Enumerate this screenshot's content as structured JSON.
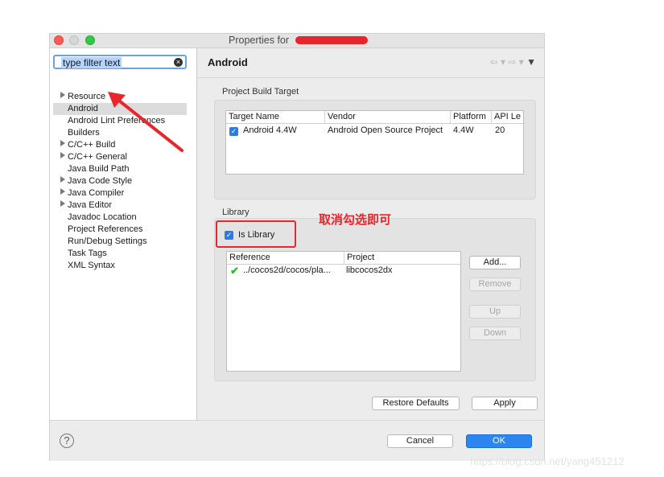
{
  "window": {
    "title": "Properties for "
  },
  "filter": {
    "placeholder": "type filter text"
  },
  "tree": [
    {
      "label": "Resource",
      "expandable": true,
      "selected": false
    },
    {
      "label": "Android",
      "expandable": false,
      "selected": true
    },
    {
      "label": "Android Lint Preferences",
      "expandable": false,
      "selected": false
    },
    {
      "label": "Builders",
      "expandable": false,
      "selected": false
    },
    {
      "label": "C/C++ Build",
      "expandable": true,
      "selected": false
    },
    {
      "label": "C/C++ General",
      "expandable": true,
      "selected": false
    },
    {
      "label": "Java Build Path",
      "expandable": false,
      "selected": false
    },
    {
      "label": "Java Code Style",
      "expandable": true,
      "selected": false
    },
    {
      "label": "Java Compiler",
      "expandable": true,
      "selected": false
    },
    {
      "label": "Java Editor",
      "expandable": true,
      "selected": false
    },
    {
      "label": "Javadoc Location",
      "expandable": false,
      "selected": false
    },
    {
      "label": "Project References",
      "expandable": false,
      "selected": false
    },
    {
      "label": "Run/Debug Settings",
      "expandable": false,
      "selected": false
    },
    {
      "label": "Task Tags",
      "expandable": false,
      "selected": false
    },
    {
      "label": "XML Syntax",
      "expandable": false,
      "selected": false
    }
  ],
  "main": {
    "title": "Android",
    "build_target": {
      "label": "Project Build Target",
      "columns": [
        "Target Name",
        "Vendor",
        "Platform",
        "API Le"
      ],
      "rows": [
        {
          "checked": true,
          "name": "Android 4.4W",
          "vendor": "Android Open Source Project",
          "platform": "4.4W",
          "api": "20"
        }
      ]
    },
    "library": {
      "label": "Library",
      "is_library_label": "Is Library",
      "is_library_checked": true,
      "columns": [
        "Reference",
        "Project"
      ],
      "rows": [
        {
          "reference": "../cocos2d/cocos/pla...",
          "project": "libcocos2dx"
        }
      ],
      "buttons": {
        "add": "Add...",
        "remove": "Remove",
        "up": "Up",
        "down": "Down"
      }
    },
    "restore_defaults": "Restore Defaults",
    "apply": "Apply"
  },
  "footer": {
    "cancel": "Cancel",
    "ok": "OK"
  },
  "annotation": {
    "text": "取消勾选即可",
    "color": "#e8262c"
  },
  "watermark": "https://blog.csdn.net/yang451212"
}
